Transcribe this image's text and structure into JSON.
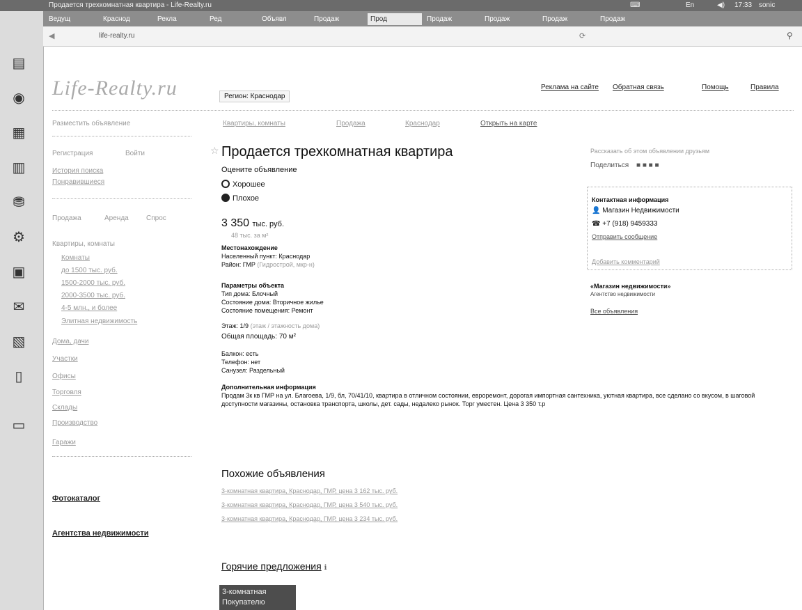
{
  "os": {
    "top_title": "Продается трехкомнатная квартира - Life-Realty.ru",
    "lang": "En",
    "time": "17:33",
    "user": "sonic"
  },
  "tabs": [
    {
      "label": "Ведущ"
    },
    {
      "label": "Краснод"
    },
    {
      "label": "Рекла"
    },
    {
      "label": "Ред"
    },
    {
      "label": "Объявл"
    },
    {
      "label": "Продаж"
    },
    {
      "label": "Прод"
    },
    {
      "label": "Продаж"
    },
    {
      "label": "Продаж"
    },
    {
      "label": "Продаж"
    },
    {
      "label": "Продаж"
    }
  ],
  "urlbar": {
    "domain": "life-realty.ru"
  },
  "header": {
    "logo": "Life-Realty.ru",
    "region": "Регион: Краснодар",
    "links": [
      "Реклама на сайте",
      "Обратная связь",
      "Помощь",
      "Правила"
    ],
    "login": "Войти"
  },
  "sidebar": {
    "post_ad": "Разместить объявление",
    "register": "Регистрация",
    "login": "Войти",
    "search_history": "История поиска",
    "favorites": "Понравившиеся",
    "tabs": [
      "Продажа",
      "Аренда",
      "Спрос"
    ],
    "category_header": "Квартиры, комнаты",
    "categories": [
      "Комнаты",
      "до 1500 тыс. руб.",
      "1500-2000 тыс. руб.",
      "2000-3500 тыс. руб.",
      "4-5 млн., и более",
      "Элитная недвижимость",
      "Дома, дачи",
      "Участки",
      "Офисы",
      "Торговля",
      "Склады",
      "Производство",
      "Гаражи"
    ],
    "photo_catalog": "Фотокаталог",
    "agencies": "Агентства недвижимости"
  },
  "breadcrumbs": [
    "Квартиры, комнаты",
    "Продажа",
    "Краснодар",
    "Открыть на карте"
  ],
  "listing": {
    "title": "Продается трехкомнатная квартира",
    "rate_label": "Оцените объявление",
    "rate_good": "Хорошее",
    "rate_bad": "Плохое",
    "price": "3 350",
    "price_unit": "тыс. руб.",
    "price_per_m2": "48 тыс. за м²",
    "location_header": "Местонахождение",
    "city_label": "Населенный пункт:",
    "city": "Краснодар",
    "district_label": "Район:",
    "district": "ГМР",
    "district_extra": "(Гидрострой, мкр-н)",
    "params_header": "Параметры объекта",
    "params": [
      "Тип дома: Блочный",
      "Состояние дома: Вторичное жилье",
      "Состояние помещения: Ремонт"
    ],
    "floor_label": "Этаж:",
    "floor": "1/9",
    "floor_extra": "(этаж / этажность дома)",
    "area_label": "Общая площадь:",
    "area": "70 м²",
    "extras": [
      "Балкон: есть",
      "Телефон: нет",
      "Санузел: Раздельный"
    ],
    "info_header": "Дополнительная информация",
    "info_text": "Продам 3к кв ГМР на ул. Благоева, 1/9, бл, 70/41/10, квартира в отличном состоянии, евроремонт, дорогая импортная сантехника, уютная квартира, все сделано со вкусом, в шаговой доступности магазины, остановка транспорта, школы, дет. сады, недалеко рынок. Торг уместен. Цена 3 350 т.р"
  },
  "right": {
    "share_top": "Рассказать об этом объявлении друзьям",
    "share_label": "Поделиться",
    "contact_header": "Контактная информация",
    "contact_name": "Магазин Недвижимости",
    "contact_phone": "+7 (918) 9459333",
    "send_message": "Отправить сообщение",
    "add_comment": "Добавить комментарий",
    "agency_title": "«Магазин недвижимости»",
    "agency_sub": "Агентство недвижимости",
    "all_ads": "Все объявления"
  },
  "similar": {
    "header": "Похожие объявления",
    "items": [
      "3-комнатная квартира, Краснодар, ГМР, цена 3 162 тыс. руб.",
      "3-комнатная квартира, Краснодар, ГМР, цена 3 540 тыс. руб.",
      "3-комнатная квартира, Краснодар, ГМР, цена 3 234 тыс. руб."
    ]
  },
  "hot": {
    "header": "Горячие предложения",
    "card_line1": "3-комнатная",
    "card_line2": "Покупателю"
  }
}
